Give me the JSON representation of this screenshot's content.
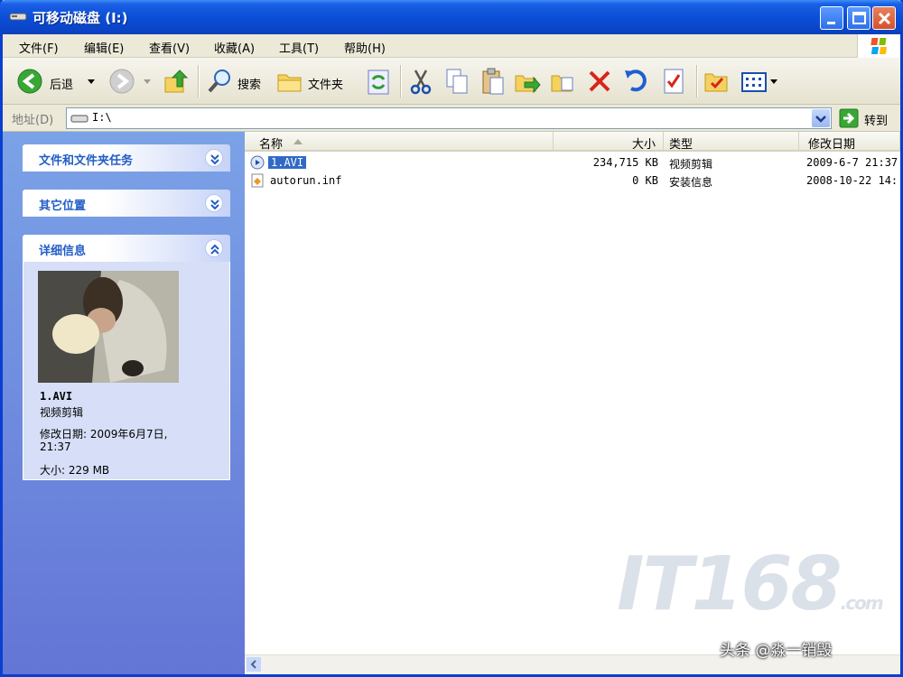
{
  "window": {
    "title": "可移动磁盘 (I:)"
  },
  "menu": [
    "文件(F)",
    "编辑(E)",
    "查看(V)",
    "收藏(A)",
    "工具(T)",
    "帮助(H)"
  ],
  "toolbar": {
    "back_label": "后退",
    "search_label": "搜索",
    "folders_label": "文件夹"
  },
  "address": {
    "label": "地址(D)",
    "value": "I:\\",
    "go_label": "转到"
  },
  "taskpane": {
    "panel1_title": "文件和文件夹任务",
    "panel2_title": "其它位置",
    "panel3_title": "详细信息",
    "details": {
      "name": "1.AVI",
      "type": "视频剪辑",
      "modified_line1": "修改日期: 2009年6月7日,",
      "modified_line2": "21:37",
      "size": "大小: 229 MB"
    }
  },
  "columns": {
    "name": "名称",
    "size": "大小",
    "type": "类型",
    "modified": "修改日期"
  },
  "files": [
    {
      "name": "1.AVI",
      "size": "234,715 KB",
      "type": "视频剪辑",
      "modified": "2009-6-7 21:37"
    },
    {
      "name": "autorun.inf",
      "size": "0 KB",
      "type": "安装信息",
      "modified": "2008-10-22 14:"
    }
  ],
  "watermark": {
    "text": "IT168",
    "suffix": ".com"
  },
  "caption": "头条 @淼一销毁",
  "colors": {
    "title_blue": "#0b4fd8",
    "pane_blue": "#7ba2e7",
    "selection": "#316ac5"
  }
}
